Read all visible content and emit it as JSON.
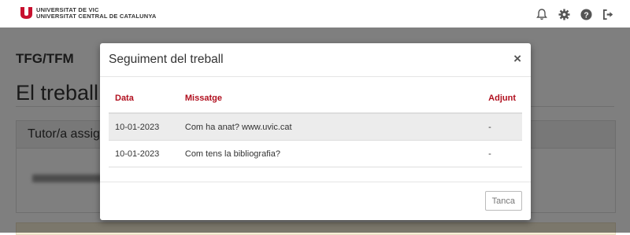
{
  "header": {
    "logo_line1": "UNIVERSITAT DE VIC",
    "logo_line2": "UNIVERSITAT CENTRAL DE CATALUNYA",
    "brand_color": "#c8102e",
    "icons": [
      "bell-icon",
      "gear-icon",
      "help-icon",
      "logout-icon"
    ]
  },
  "page": {
    "breadcrumb": "TFG/TFM",
    "title": "El treball",
    "panel_heading": "Tutor/a assig"
  },
  "modal": {
    "title": "Seguiment del treball",
    "close_symbol": "×",
    "columns": [
      "Data",
      "Missatge",
      "Adjunt"
    ],
    "rows": [
      {
        "date": "10-01-2023",
        "message": "Com ha anat? www.uvic.cat",
        "attachment": "-"
      },
      {
        "date": "10-01-2023",
        "message": "Com tens la bibliografia?",
        "attachment": "-"
      }
    ],
    "close_button": "Tanca"
  }
}
